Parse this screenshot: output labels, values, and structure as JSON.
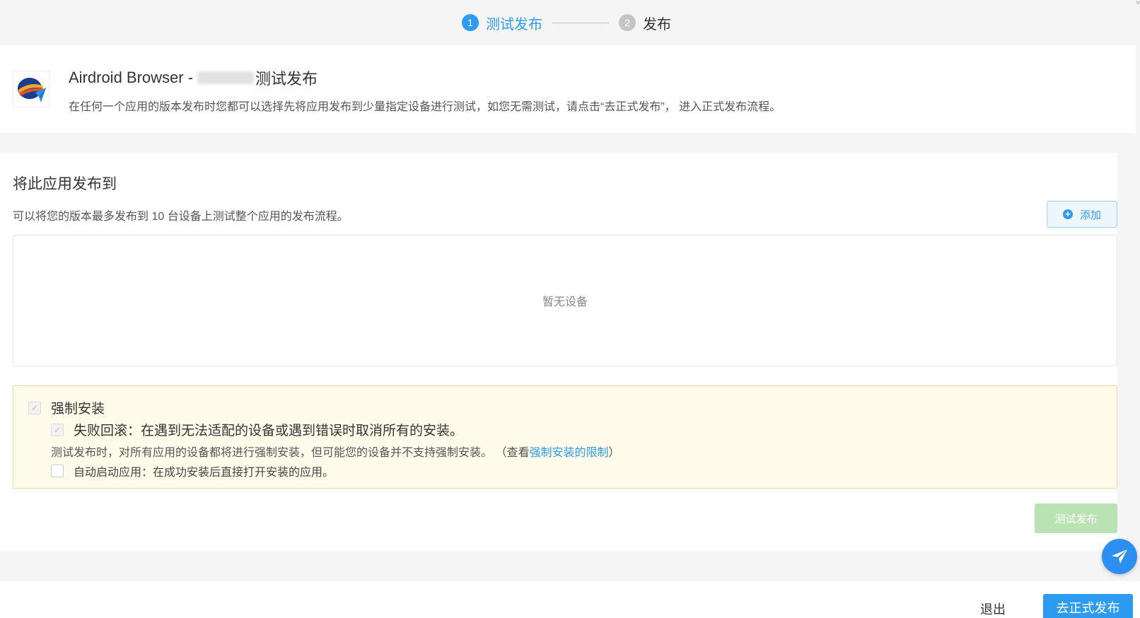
{
  "stepper": {
    "steps": [
      {
        "number": "1",
        "label": "测试发布",
        "state": "active"
      },
      {
        "number": "2",
        "label": "发布",
        "state": "inactive"
      }
    ]
  },
  "app": {
    "name": "Airdroid Browser -",
    "version_label": "测试发布",
    "description": "在任何一个应用的版本发布时您都可以选择先将应用发布到少量指定设备进行测试，如您无需测试，请点击“去正式发布”， 进入正式发布流程。"
  },
  "publish_target": {
    "title": "将此应用发布到",
    "description": "可以将您的版本最多发布到 10 台设备上测试整个应用的发布流程。",
    "add_label": "添加",
    "empty_text": "暂无设备"
  },
  "options": {
    "force_install": {
      "label": "强制安装",
      "checked": true,
      "disabled": true
    },
    "rollback": {
      "label": "失败回滚：在遇到无法适配的设备或遇到错误时取消所有的安装。",
      "checked": true,
      "disabled": true
    },
    "note_prefix": "测试发布时，对所有应用的设备都将进行强制安装，但可能您的设备并不支持强制安装。 （查看",
    "note_link": "强制安装的限制",
    "note_suffix": "）",
    "auto_launch": {
      "label": "自动启动应用：在成功安装后直接打开安装的应用。",
      "checked": false
    }
  },
  "actions": {
    "test_publish_label": "测试发布",
    "exit_label": "退出",
    "go_publish_label": "去正式发布"
  },
  "colors": {
    "primary": "#2d9bf0",
    "disabled_green": "#b9e3b2",
    "notice_bg": "#fffbeb"
  }
}
